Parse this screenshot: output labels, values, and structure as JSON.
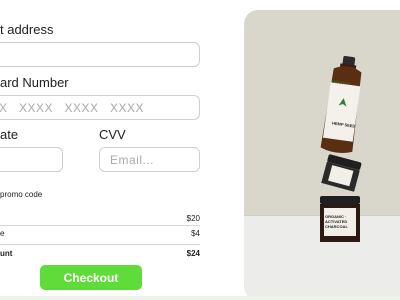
{
  "form": {
    "address_label": "t address",
    "card_label": "ard Number",
    "card_placeholder": "X   XXXX   XXXX   XXXX",
    "date_label": "ate",
    "cvv_label": "CVV",
    "cvv_placeholder": "Email...",
    "promo_label": "promo code"
  },
  "summary": {
    "rows": [
      {
        "label": "",
        "value": "$20"
      },
      {
        "label": "e",
        "value": "$4"
      }
    ],
    "total_label": "unt",
    "total_value": "$24"
  },
  "checkout": {
    "label": "Checkout",
    "color": "#5fdc3a"
  },
  "product": {
    "bottle_brand": "BIOLOGY",
    "bottle_label": "HEMP SEED",
    "jar_label": "ORGANIC · ACTIVATED CHARCOAL"
  }
}
